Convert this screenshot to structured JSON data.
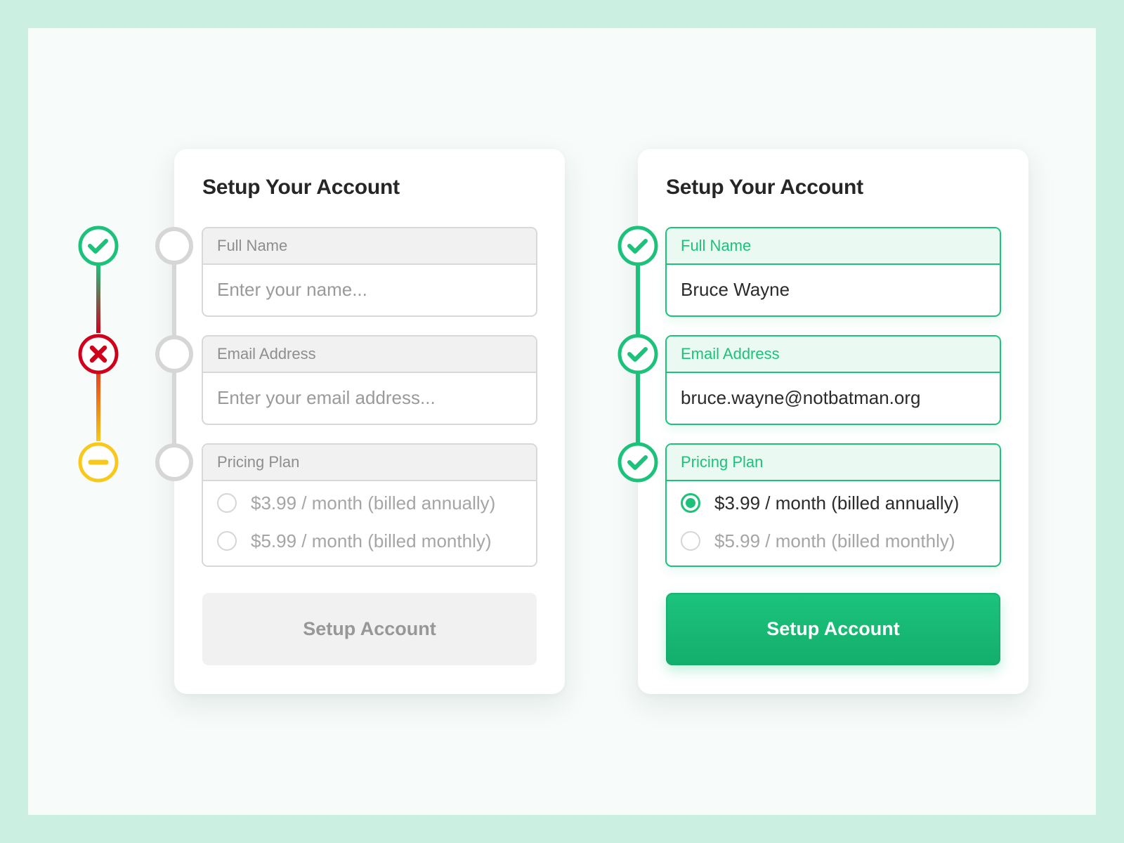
{
  "colors": {
    "outer_bg": "#CBF0E1",
    "panel_bg": "#F7FBFA",
    "success": "#1DC27A",
    "error": "#D0021B",
    "warning": "#F8C81C",
    "neutral": "#D6D6D6"
  },
  "status_legend": {
    "items": [
      {
        "icon": "check-circle-icon",
        "status": "success"
      },
      {
        "icon": "x-circle-icon",
        "status": "error"
      },
      {
        "icon": "minus-circle-icon",
        "status": "warning"
      }
    ]
  },
  "empty_form": {
    "title": "Setup Your Account",
    "steps": [
      {
        "icon": "empty-circle-icon",
        "status": "incomplete"
      },
      {
        "icon": "empty-circle-icon",
        "status": "incomplete"
      },
      {
        "icon": "empty-circle-icon",
        "status": "incomplete"
      }
    ],
    "full_name": {
      "label": "Full Name",
      "value": "",
      "placeholder": "Enter your name..."
    },
    "email": {
      "label": "Email Address",
      "value": "",
      "placeholder": "Enter your email address..."
    },
    "pricing": {
      "label": "Pricing Plan",
      "options": [
        {
          "label": "$3.99 / month (billed annually)",
          "selected": false
        },
        {
          "label": "$5.99 / month (billed monthly)",
          "selected": false
        }
      ]
    },
    "submit_label": "Setup Account",
    "submit_enabled": false
  },
  "filled_form": {
    "title": "Setup Your Account",
    "steps": [
      {
        "icon": "check-circle-icon",
        "status": "complete"
      },
      {
        "icon": "check-circle-icon",
        "status": "complete"
      },
      {
        "icon": "check-circle-icon",
        "status": "complete"
      }
    ],
    "full_name": {
      "label": "Full Name",
      "value": "Bruce Wayne",
      "placeholder": ""
    },
    "email": {
      "label": "Email Address",
      "value": "bruce.wayne@notbatman.org",
      "placeholder": ""
    },
    "pricing": {
      "label": "Pricing Plan",
      "options": [
        {
          "label": "$3.99 / month (billed annually)",
          "selected": true
        },
        {
          "label": "$5.99 / month (billed monthly)",
          "selected": false
        }
      ]
    },
    "submit_label": "Setup Account",
    "submit_enabled": true
  }
}
